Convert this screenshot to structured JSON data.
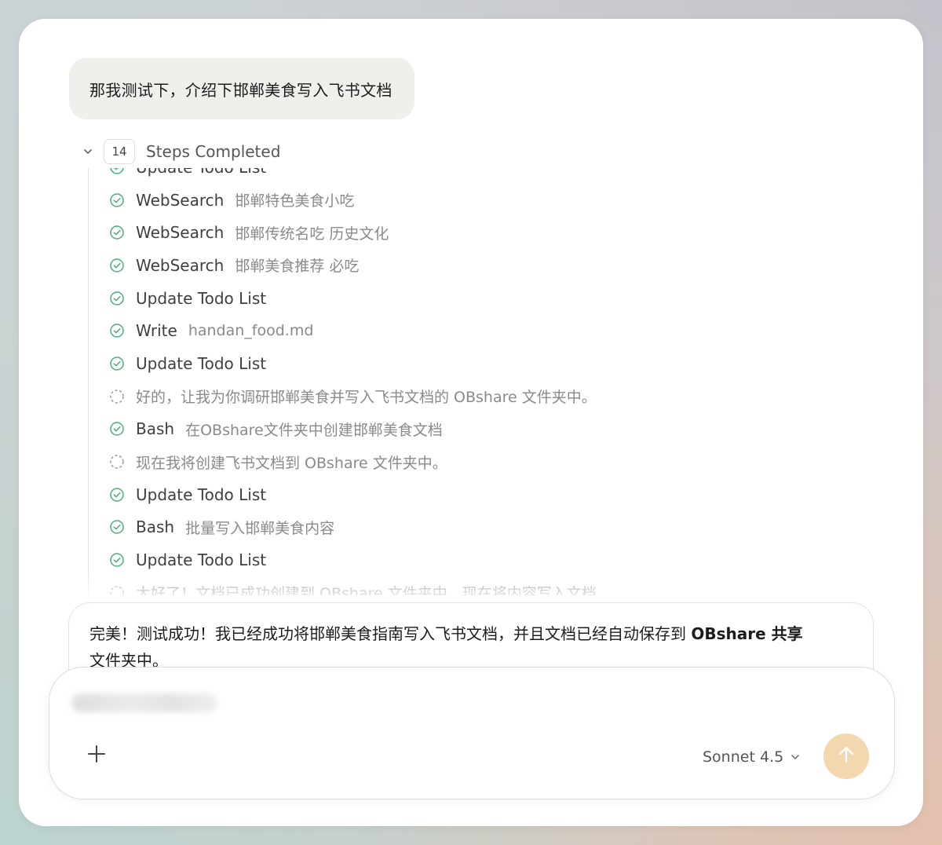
{
  "user_message": "那我测试下，介绍下邯郸美食写入飞书文档",
  "steps": {
    "count": "14",
    "title": "Steps Completed",
    "items": [
      {
        "type": "done",
        "label": "Update Todo List",
        "detail": ""
      },
      {
        "type": "done",
        "label": "WebSearch",
        "detail": "邯郸特色美食小吃"
      },
      {
        "type": "done",
        "label": "WebSearch",
        "detail": "邯郸传统名吃 历史文化"
      },
      {
        "type": "done",
        "label": "WebSearch",
        "detail": "邯郸美食推荐 必吃"
      },
      {
        "type": "done",
        "label": "Update Todo List",
        "detail": ""
      },
      {
        "type": "done",
        "label": "Write",
        "detail": "handan_food.md"
      },
      {
        "type": "done",
        "label": "Update Todo List",
        "detail": ""
      },
      {
        "type": "thought",
        "label": "好的，让我为你调研邯郸美食并写入飞书文档的 OBshare 文件夹中。",
        "detail": ""
      },
      {
        "type": "done",
        "label": "Bash",
        "detail": "在OBshare文件夹中创建邯郸美食文档"
      },
      {
        "type": "thought",
        "label": "现在我将创建飞书文档到 OBshare 文件夹中。",
        "detail": ""
      },
      {
        "type": "done",
        "label": "Update Todo List",
        "detail": ""
      },
      {
        "type": "done",
        "label": "Bash",
        "detail": "批量写入邯郸美食内容"
      },
      {
        "type": "done",
        "label": "Update Todo List",
        "detail": ""
      },
      {
        "type": "thought",
        "label": "太好了！文档已成功创建到 OBshare 文件夹中，现在将内容写入文档",
        "detail": ""
      }
    ]
  },
  "assistant_reply": {
    "lead": "完美！测试成功！我已经成功将邯郸美食指南写入飞书文档，并且文档已经自动保存到 ",
    "bold": "OBshare 共享",
    "tail": "文件夹中。"
  },
  "composer": {
    "placeholder": "",
    "model": "Sonnet 4.5"
  },
  "colors": {
    "accent_green": "#4caf78",
    "send_button": "#f3d7ae",
    "user_bubble": "#f0efeb"
  },
  "icons": {
    "step_done": "check-circle-icon",
    "step_thought": "dashed-circle-icon",
    "collapse": "chevron-down-icon",
    "add": "plus-icon",
    "send": "arrow-up-icon"
  }
}
